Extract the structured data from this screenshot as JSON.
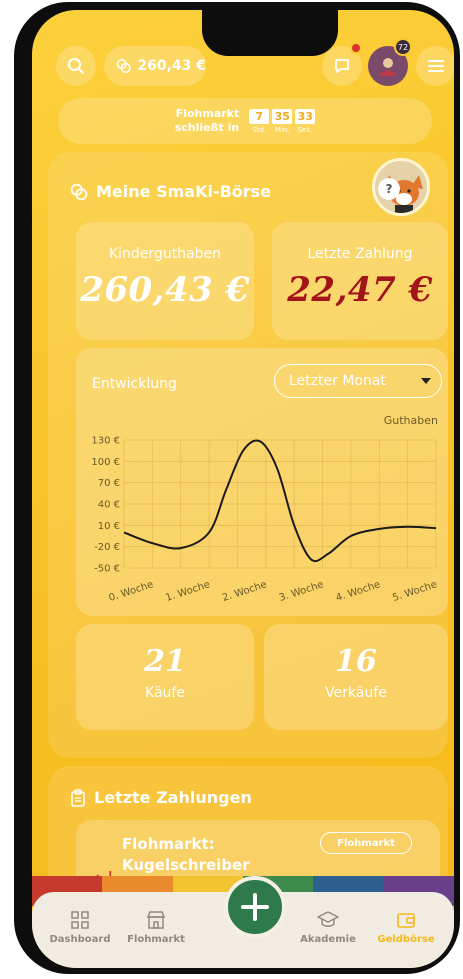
{
  "header": {
    "balance": "260,43 €",
    "notification_badge": "",
    "profile_badge": "72"
  },
  "timer": {
    "label_line1": "Flohmarkt",
    "label_line2": "schließt in",
    "hours": "7",
    "hours_unit": "Std.",
    "minutes": "35",
    "minutes_unit": "Min.",
    "seconds": "33",
    "seconds_unit": "Sek."
  },
  "wallet": {
    "title": "Meine SmaKi-Börse",
    "help": "?",
    "kids_balance_label": "Kinderguthaben",
    "kids_balance_value": "260,43 €",
    "last_payment_label": "Letzte Zahlung",
    "last_payment_value": "22,47 €",
    "colors": {
      "kids_balance": "#ffffff",
      "last_payment": "#a3131a"
    }
  },
  "development": {
    "title": "Entwicklung",
    "period_selected": "Letzter Monat"
  },
  "chart_data": {
    "type": "line",
    "title": "",
    "series": [
      {
        "name": "Guthaben",
        "x": [
          0,
          0.5,
          1,
          1.5,
          1.8,
          2.1,
          2.4,
          2.7,
          3.0,
          3.3,
          3.6,
          4.0,
          4.5,
          5.0,
          5.5
        ],
        "values": [
          0,
          -15,
          -22,
          0,
          60,
          115,
          128,
          90,
          10,
          -38,
          -30,
          -5,
          5,
          8,
          6
        ]
      }
    ],
    "x_tick_labels": [
      "0. Woche",
      "1. Woche",
      "2. Woche",
      "3. Woche",
      "4. Woche",
      "5. Woche"
    ],
    "y_tick_labels": [
      "130 €",
      "100 €",
      "70 €",
      "40 €",
      "10 €",
      "-20 €",
      "-50 €"
    ],
    "y_ticks": [
      130,
      100,
      70,
      40,
      10,
      -20,
      -50
    ],
    "ylim": [
      -50,
      130
    ],
    "xlim": [
      0,
      5.5
    ],
    "grid": true,
    "legend": "top-right"
  },
  "counts": {
    "purchases_value": "21",
    "purchases_label": "Käufe",
    "sales_value": "16",
    "sales_label": "Verkäufe"
  },
  "payments": {
    "title": "Letzte Zahlungen",
    "items": [
      {
        "title": "Flohmarkt: Kugelschreiber",
        "tag": "Flohmarkt"
      }
    ]
  },
  "nav": {
    "items": [
      {
        "label": "Dashboard",
        "icon": "grid-icon"
      },
      {
        "label": "Flohmarkt",
        "icon": "shop-icon"
      },
      {
        "label": "Akademie",
        "icon": "graduation-cap-icon"
      },
      {
        "label": "Geldbörse",
        "icon": "wallet-icon"
      }
    ],
    "active": "Geldbörse"
  },
  "theme": {
    "accent": "#f5b81a",
    "fab": "#2e7a4a"
  }
}
